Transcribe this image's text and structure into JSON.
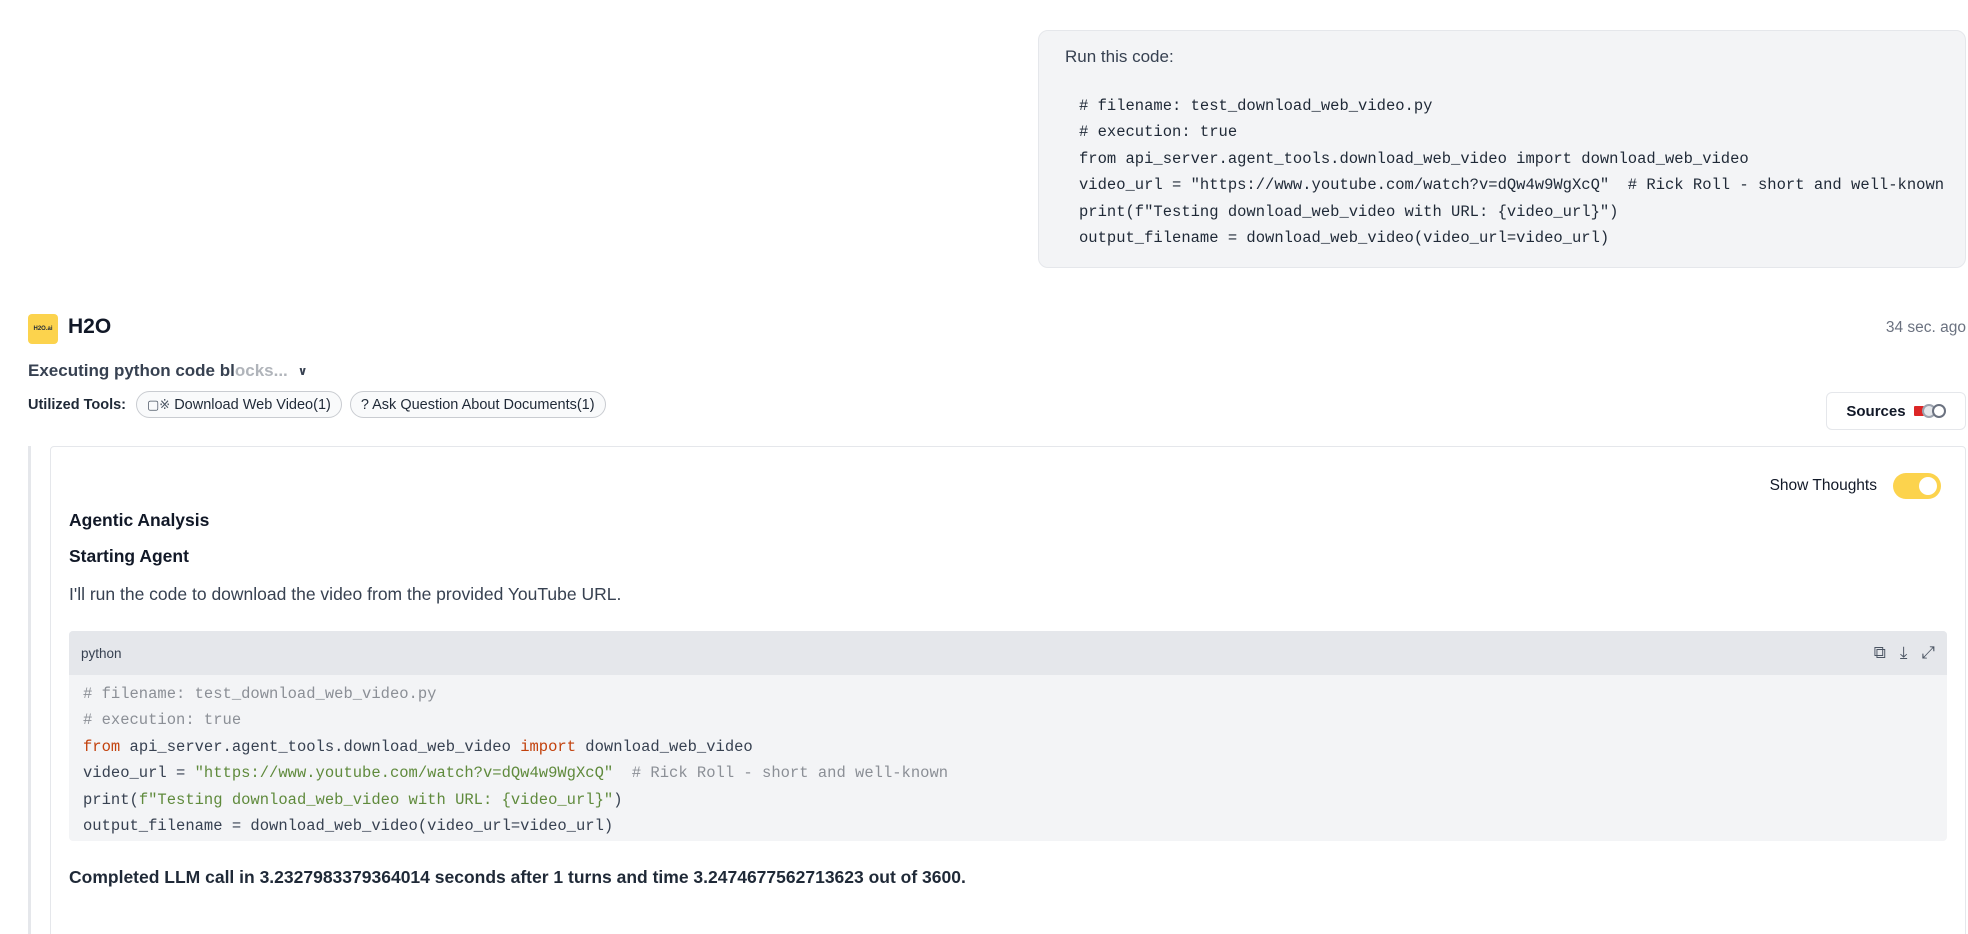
{
  "user_message": {
    "prompt": "Run this code:",
    "code_lines": [
      "# filename: test_download_web_video.py",
      "# execution: true",
      "from api_server.agent_tools.download_web_video import download_web_video",
      "video_url = \"https://www.youtube.com/watch?v=dQw4w9WgXcQ\"  # Rick Roll - short and well-known",
      "print(f\"Testing download_web_video with URL: {video_url}\")",
      "output_filename = download_web_video(video_url=video_url)"
    ]
  },
  "assistant": {
    "avatar_text": "H2O.ai",
    "name": "H2O",
    "timestamp": "34 sec. ago",
    "status_main": "Executing python code bl",
    "status_fade": "ocks...",
    "tools_label": "Utilized Tools:",
    "tools": [
      {
        "icon": "video-icon",
        "label": "Download Web Video(1)"
      },
      {
        "icon": "question-icon",
        "label": "? Ask Question About Documents(1)"
      }
    ],
    "sources_label": "Sources"
  },
  "thoughts": {
    "toggle_label": "Show Thoughts",
    "toggle_on": true,
    "heading": "Agentic Analysis",
    "subheading": "Starting Agent",
    "intro": "I'll run the code to download the video from the provided YouTube URL.",
    "code_language": "python",
    "code": {
      "l1": "# filename: test_download_web_video.py",
      "l2": "# execution: true",
      "l3_kw": "from",
      "l3_a": " api_server.agent_tools.download_web_video ",
      "l3_kw2": "import",
      "l3_b": " download_web_video",
      "l4_a": "video_url = ",
      "l4_str": "\"https://www.youtube.com/watch?v=dQw4w9WgXcQ\"",
      "l4_com": "  # Rick Roll - short and well-known",
      "l5_a": "print(",
      "l5_str": "f\"Testing download_web_video with URL: {video_url}\"",
      "l5_b": ")",
      "l6": "output_filename = download_web_video(video_url=video_url)"
    },
    "completed": "Completed LLM call in 3.2327983379364014 seconds after 1 turns and time 3.2474677562713623 out of 3600."
  },
  "colors": {
    "accent": "#fcd34d",
    "source_red": "#dc2626"
  }
}
